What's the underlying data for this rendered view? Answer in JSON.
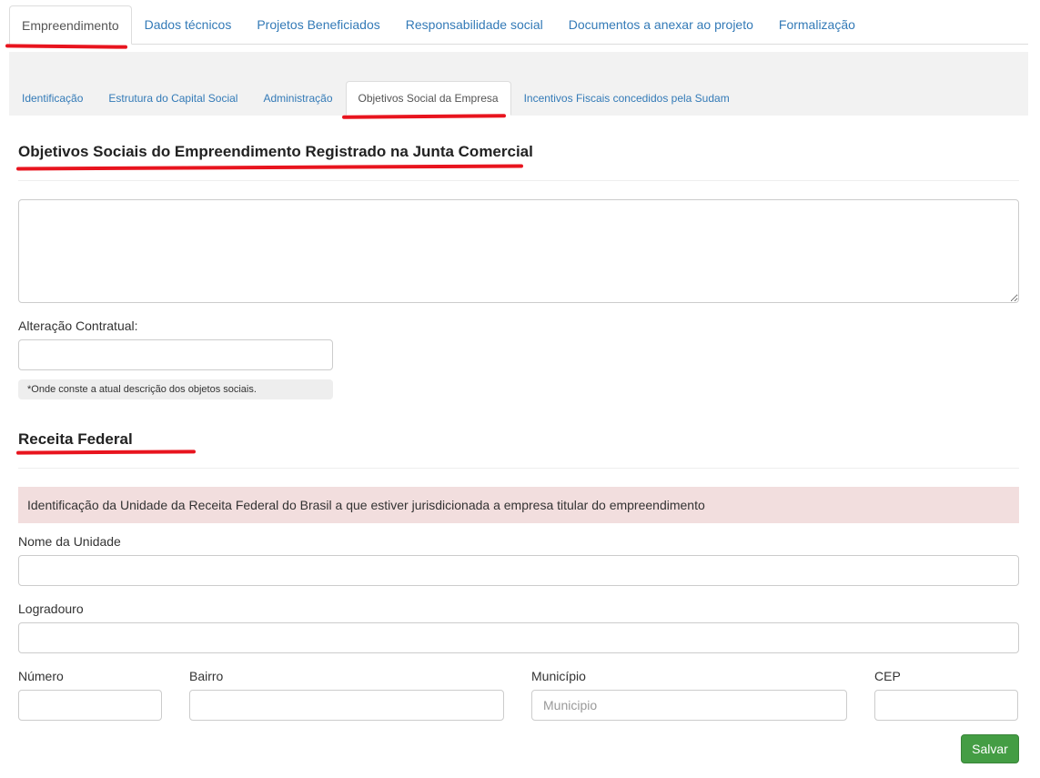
{
  "top_tabs": [
    {
      "label": "Empreendimento",
      "active": true
    },
    {
      "label": "Dados técnicos",
      "active": false
    },
    {
      "label": "Projetos Beneficiados",
      "active": false
    },
    {
      "label": "Responsabilidade social",
      "active": false
    },
    {
      "label": "Documentos a anexar ao projeto",
      "active": false
    },
    {
      "label": "Formalização",
      "active": false
    }
  ],
  "sub_tabs": [
    {
      "label": "Identificação",
      "active": false
    },
    {
      "label": "Estrutura do Capital Social",
      "active": false
    },
    {
      "label": "Administração",
      "active": false
    },
    {
      "label": "Objetivos Social da Empresa",
      "active": true
    },
    {
      "label": "Incentivos Fiscais concedidos pela Sudam",
      "active": false
    }
  ],
  "objetivos": {
    "title": "Objetivos Sociais do Empreendimento Registrado na Junta Comercial",
    "textarea_value": "",
    "alteracao_label": "Alteração Contratual:",
    "alteracao_value": "",
    "help_text": "*Onde conste a atual descrição dos objetos sociais."
  },
  "receita": {
    "title": "Receita Federal",
    "alert": "Identificação da Unidade da Receita Federal do Brasil a que estiver jurisdicionada a empresa titular do empreendimento",
    "nome_unidade_label": "Nome da Unidade",
    "logradouro_label": "Logradouro",
    "numero_label": "Número",
    "bairro_label": "Bairro",
    "municipio_label": "Município",
    "municipio_placeholder": "Municipio",
    "cep_label": "CEP"
  },
  "actions": {
    "save_label": "Salvar"
  },
  "colors": {
    "link": "#337ab7",
    "alert_bg": "#f2dede",
    "save_bg": "#449d44",
    "annotation_red": "#e8141e"
  }
}
